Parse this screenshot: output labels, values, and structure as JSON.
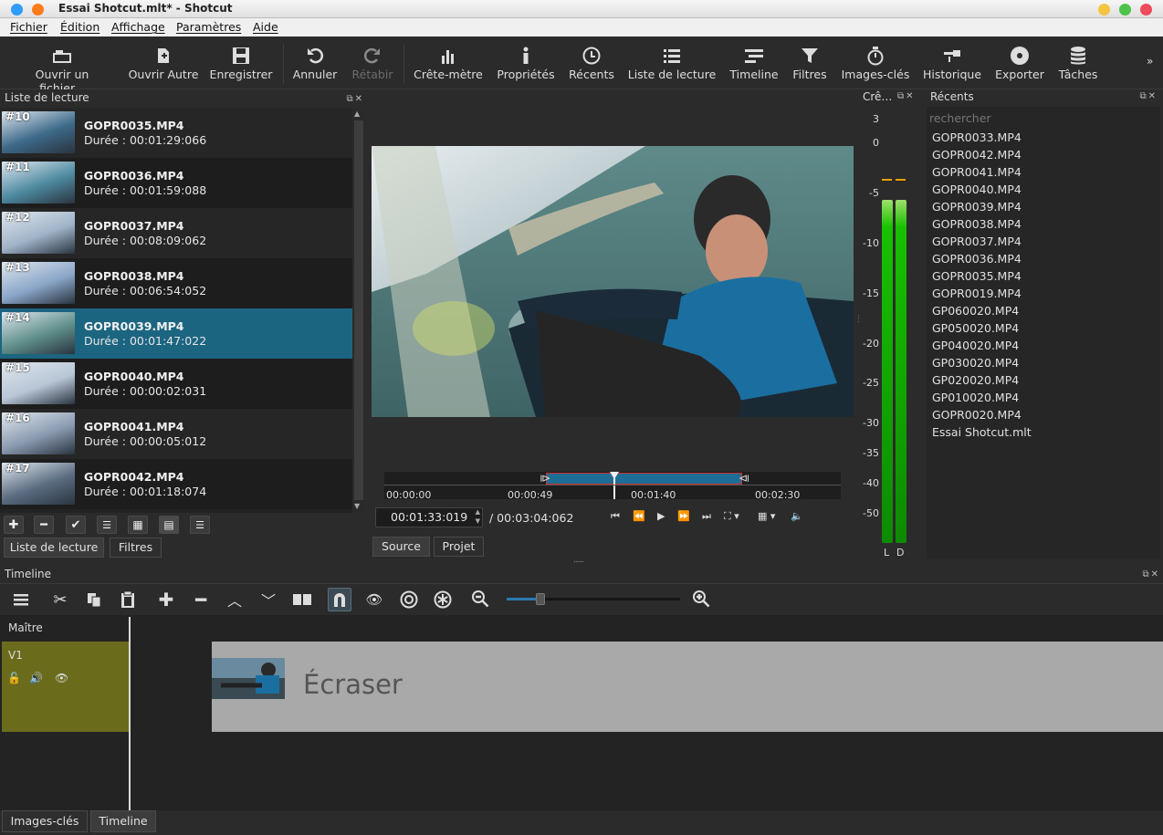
{
  "window": {
    "title": "Essai Shotcut.mlt* - Shotcut"
  },
  "menu": [
    "Fichier",
    "Édition",
    "Affichage",
    "Paramètres",
    "Aide"
  ],
  "toolbar": [
    {
      "label": "Ouvrir un fichier...",
      "icon": "open-folder-icon"
    },
    {
      "label": "Ouvrir Autre",
      "icon": "open-other-icon"
    },
    {
      "label": "Enregistrer",
      "icon": "save-icon"
    },
    {
      "label": "Annuler",
      "icon": "undo-icon"
    },
    {
      "label": "Rétabir",
      "icon": "redo-icon"
    },
    {
      "label": "Crête-mètre",
      "icon": "peak-meter-icon"
    },
    {
      "label": "Propriétés",
      "icon": "info-icon"
    },
    {
      "label": "Récents",
      "icon": "clock-icon"
    },
    {
      "label": "Liste de lecture",
      "icon": "list-icon"
    },
    {
      "label": "Timeline",
      "icon": "timeline-icon"
    },
    {
      "label": "Filtres",
      "icon": "filter-icon"
    },
    {
      "label": "Images-clés",
      "icon": "stopwatch-icon"
    },
    {
      "label": "Historique",
      "icon": "history-icon"
    },
    {
      "label": "Exporter",
      "icon": "disc-icon"
    },
    {
      "label": "Tâches",
      "icon": "database-icon"
    }
  ],
  "toolbar_more": "»",
  "playlist": {
    "title": "Liste de lecture",
    "items": [
      {
        "num": "#10",
        "name": "GOPR0035.MP4",
        "duration": "Durée : 00:01:29:066"
      },
      {
        "num": "#11",
        "name": "GOPR0036.MP4",
        "duration": "Durée : 00:01:59:088"
      },
      {
        "num": "#12",
        "name": "GOPR0037.MP4",
        "duration": "Durée : 00:08:09:062"
      },
      {
        "num": "#13",
        "name": "GOPR0038.MP4",
        "duration": "Durée : 00:06:54:052"
      },
      {
        "num": "#14",
        "name": "GOPR0039.MP4",
        "duration": "Durée : 00:01:47:022",
        "selected": true
      },
      {
        "num": "#15",
        "name": "GOPR0040.MP4",
        "duration": "Durée : 00:00:02:031"
      },
      {
        "num": "#16",
        "name": "GOPR0041.MP4",
        "duration": "Durée : 00:00:05:012"
      },
      {
        "num": "#17",
        "name": "GOPR0042.MP4",
        "duration": "Durée : 00:01:18:074"
      }
    ],
    "tabs": [
      "Liste de lecture",
      "Filtres"
    ]
  },
  "player": {
    "ruler": [
      "00:00:00",
      "00:00:49",
      "00:01:40",
      "00:02:30"
    ],
    "position": "00:01:33:019",
    "duration": "/ 00:03:04:062",
    "tabs": [
      "Source",
      "Projet"
    ]
  },
  "meter": {
    "title": "Crê…",
    "scale": [
      "3",
      "0",
      "-5",
      "-10",
      "-15",
      "-20",
      "-25",
      "-30",
      "-35",
      "-40",
      "-50"
    ],
    "channels": [
      "L",
      "D"
    ],
    "colors": {
      "bar": "#18c000",
      "peak": "#e8a000"
    }
  },
  "recent": {
    "title": "Récents",
    "search_placeholder": "rechercher",
    "items": [
      "GOPR0033.MP4",
      "GOPR0042.MP4",
      "GOPR0041.MP4",
      "GOPR0040.MP4",
      "GOPR0039.MP4",
      "GOPR0038.MP4",
      "GOPR0037.MP4",
      "GOPR0036.MP4",
      "GOPR0035.MP4",
      "GOPR0019.MP4",
      "GP060020.MP4",
      "GP050020.MP4",
      "GP040020.MP4",
      "GP030020.MP4",
      "GP020020.MP4",
      "GP010020.MP4",
      "GOPR0020.MP4",
      "Essai Shotcut.mlt"
    ]
  },
  "timeline": {
    "title": "Timeline",
    "master": "Maître",
    "track": "V1",
    "overlay_text": "Écraser",
    "bottom_tabs": [
      "Images-clés",
      "Timeline"
    ]
  }
}
